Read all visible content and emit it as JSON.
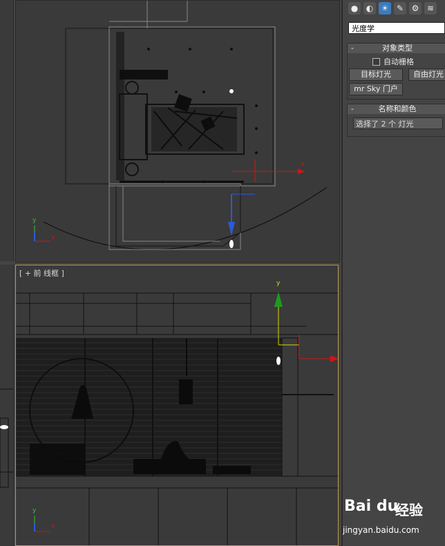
{
  "top_viewport": {
    "gizmo_x": "x",
    "axis_x": "x",
    "axis_y": "y"
  },
  "front_viewport": {
    "label": "[ + 前 线框 ]",
    "gizmo_y": "y",
    "axis_x": "x",
    "axis_y": "y"
  },
  "command_panel": {
    "tabs": [
      "●",
      "◐",
      "☀",
      "✎",
      "⚙",
      "≋"
    ],
    "name_field": "光度学",
    "object_type": {
      "title": "对象类型",
      "autogrid_label": "自动栅格",
      "buttons": [
        "目标灯光",
        "自由灯光",
        "mr Sky 门户"
      ]
    },
    "name_color": {
      "title": "名称和颜色",
      "selection_text": "选择了 2 个 灯光"
    }
  },
  "watermark": {
    "logo": "Bai du",
    "text": "经验",
    "url": "jingyan.baidu.com"
  }
}
